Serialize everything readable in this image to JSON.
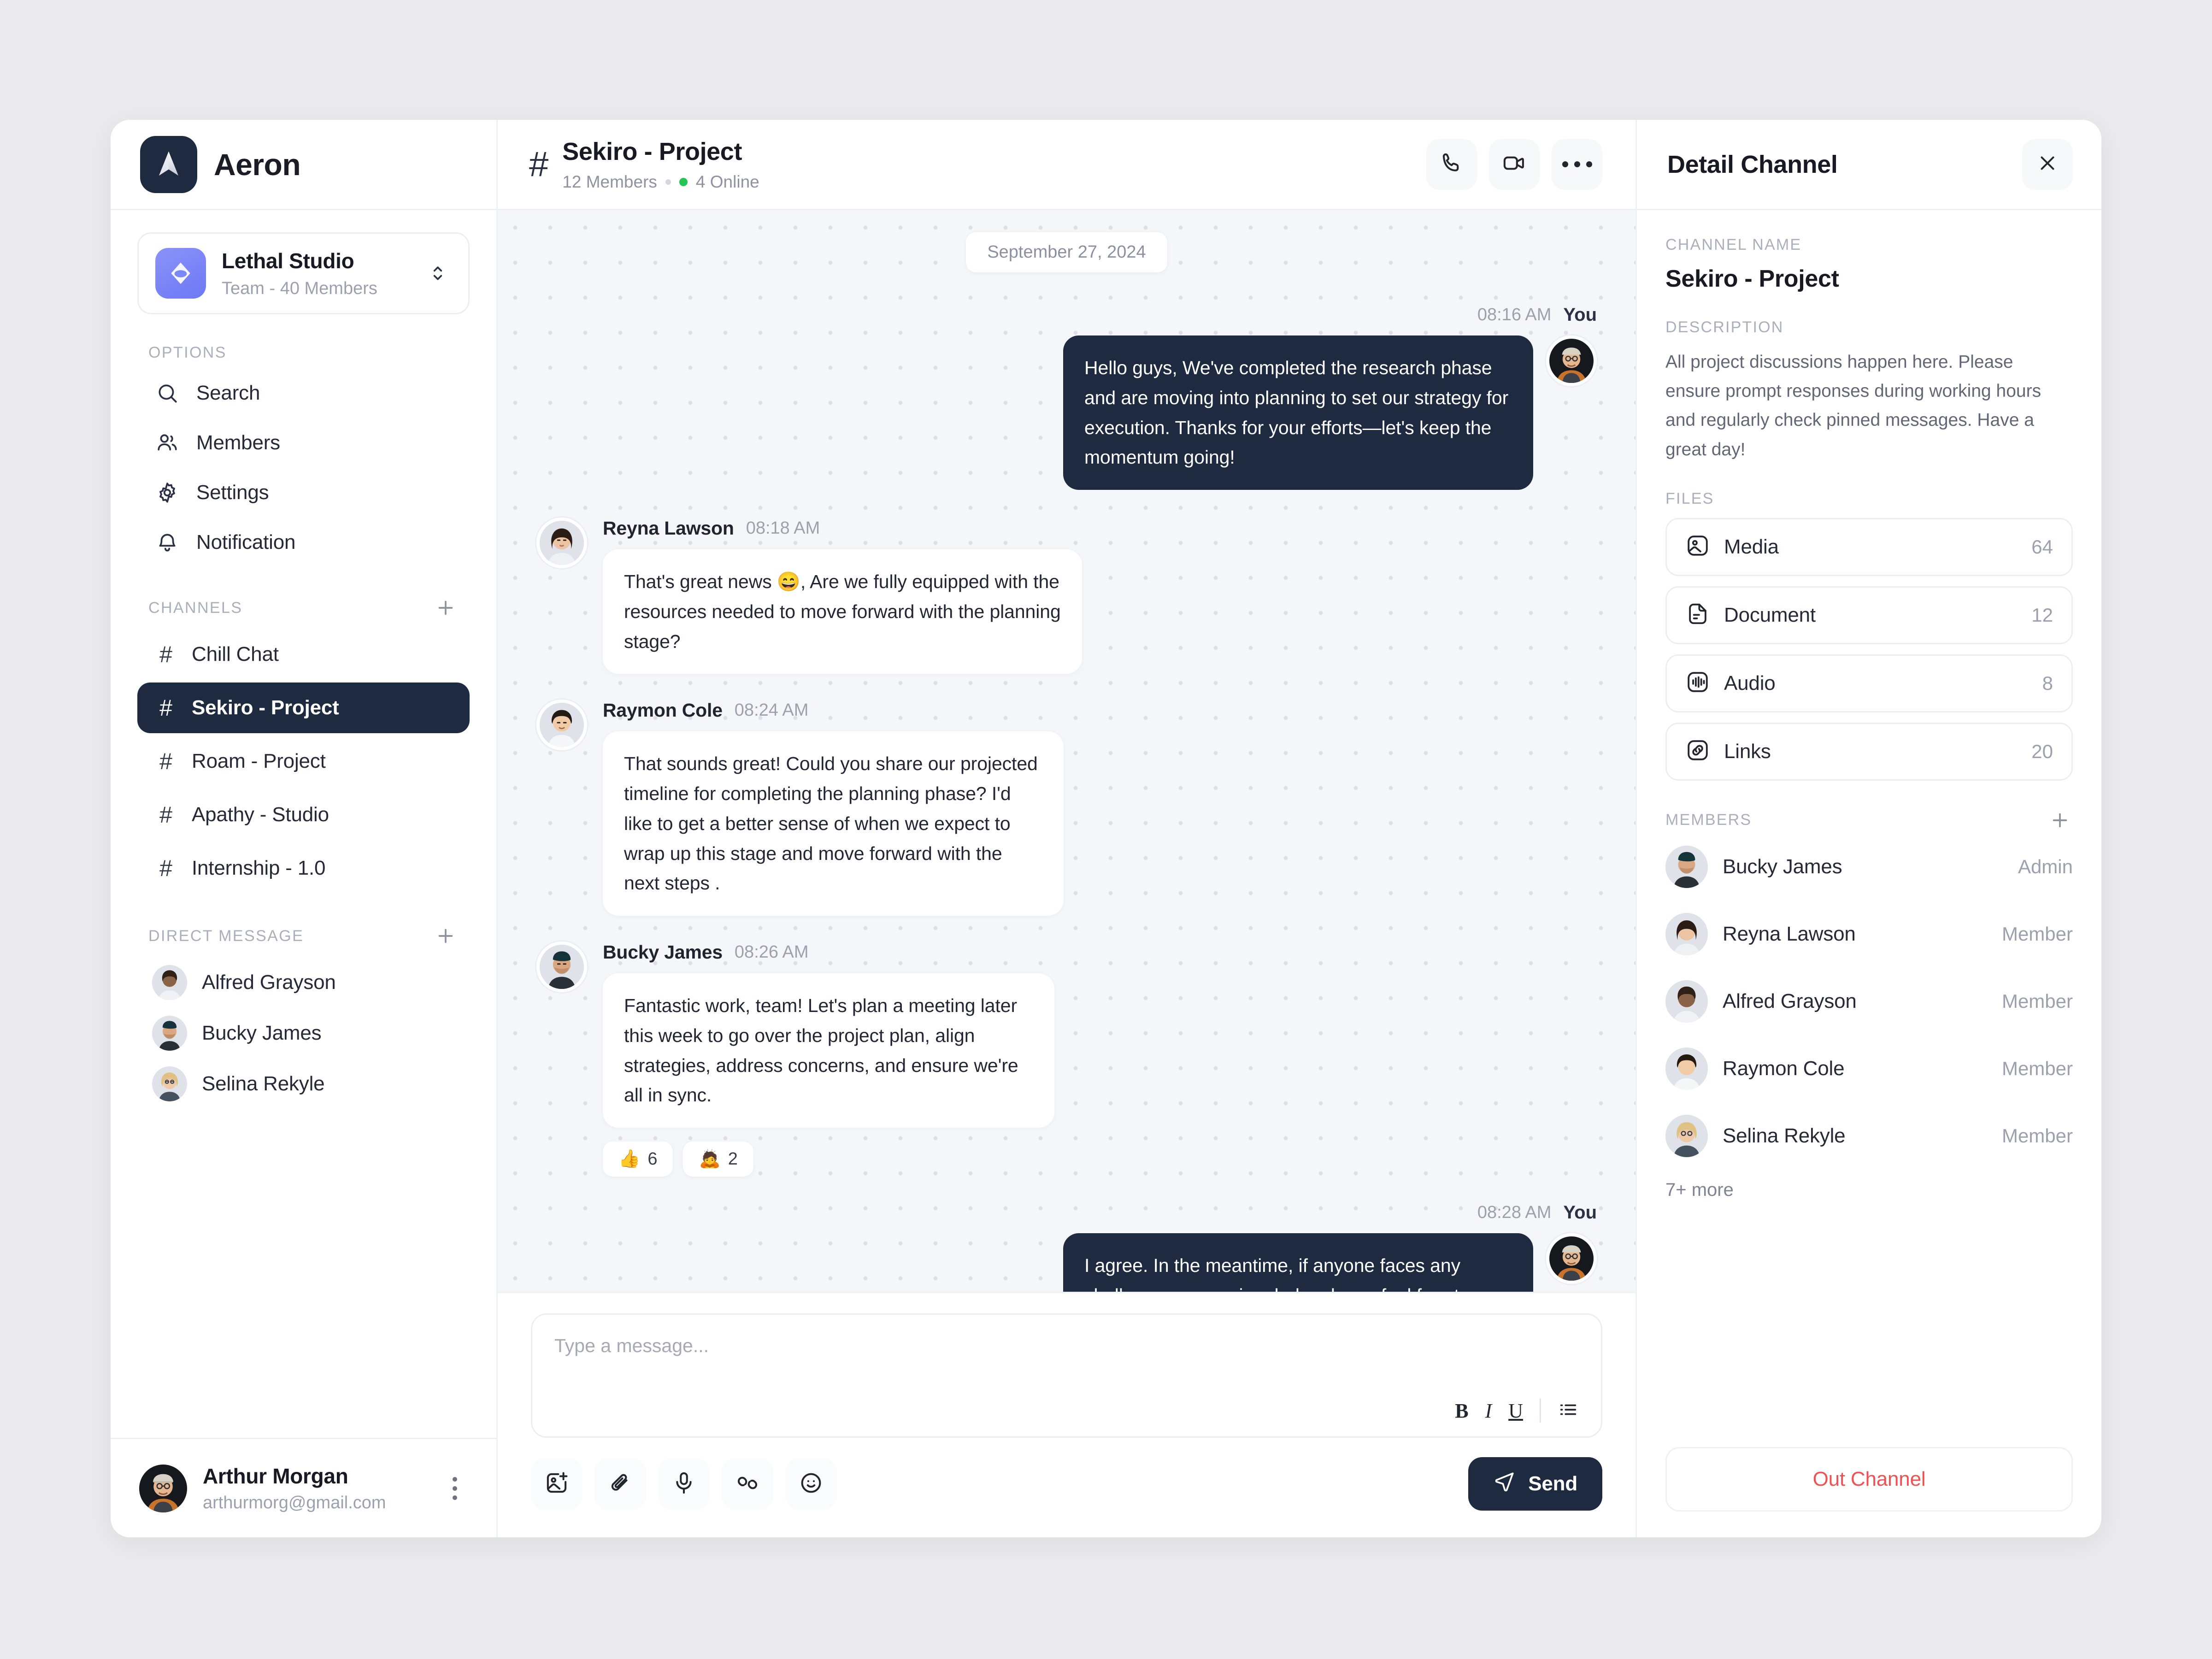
{
  "brand": {
    "name": "Aeron",
    "logo_icon": "aeron-logo-icon"
  },
  "workspace": {
    "name": "Lethal Studio",
    "subtitle": "Team - 40 Members",
    "switch_icon": "chevron-up-down-icon"
  },
  "sidebar": {
    "options_label": "OPTIONS",
    "options": [
      {
        "label": "Search",
        "icon": "search-icon"
      },
      {
        "label": "Members",
        "icon": "users-icon"
      },
      {
        "label": "Settings",
        "icon": "gear-icon"
      },
      {
        "label": "Notification",
        "icon": "bell-icon"
      }
    ],
    "channels_label": "CHANNELS",
    "add_channel_icon": "plus-icon",
    "channels": [
      {
        "label": "Chill Chat",
        "active": false
      },
      {
        "label": "Sekiro - Project",
        "active": true
      },
      {
        "label": "Roam - Project",
        "active": false
      },
      {
        "label": "Apathy - Studio",
        "active": false
      },
      {
        "label": "Internship - 1.0",
        "active": false
      }
    ],
    "dm_label": "DIRECT MESSAGE",
    "add_dm_icon": "plus-icon",
    "direct_messages": [
      {
        "label": "Alfred Grayson"
      },
      {
        "label": "Bucky James"
      },
      {
        "label": "Selina Rekyle"
      }
    ]
  },
  "current_user": {
    "name": "Arthur Morgan",
    "email": "arthurmorg@gmail.com",
    "menu_icon": "more-vertical-icon"
  },
  "chat_header": {
    "hash_icon": "hash-icon",
    "title": "Sekiro - Project",
    "members_text": "12 Members",
    "online_text": "4 Online",
    "actions": [
      {
        "icon": "phone-icon",
        "name": "voice-call-button"
      },
      {
        "icon": "video-icon",
        "name": "video-call-button"
      },
      {
        "icon": "more-horizontal-icon",
        "name": "more-options-button"
      }
    ]
  },
  "conversation": {
    "date_divider": "September 27, 2024",
    "messages": [
      {
        "side": "out",
        "author": "You",
        "time": "08:16 AM",
        "text": "Hello guys, We've completed the research phase and are moving into planning to set our strategy for execution. Thanks for your efforts—let's keep the momentum going!"
      },
      {
        "side": "in",
        "author": "Reyna Lawson",
        "time": "08:18 AM",
        "text": "That's great news 😄, Are we fully equipped with the resources needed to move forward with the planning stage?"
      },
      {
        "side": "in",
        "author": "Raymon Cole",
        "time": "08:24 AM",
        "text": "That sounds great! Could you share our projected timeline for completing the planning phase? I'd like to get a better sense of when we expect to wrap up this stage and move forward with the next steps ."
      },
      {
        "side": "in",
        "author": "Bucky James",
        "time": "08:26 AM",
        "text": "Fantastic work, team! Let's plan a meeting later this week to go over the project plan, align strategies, address concerns, and ensure we're all in sync.",
        "reactions": [
          {
            "emoji": "👍",
            "count": "6"
          },
          {
            "emoji": "🙇",
            "count": "2"
          }
        ]
      },
      {
        "side": "out",
        "author": "You",
        "time": "08:28 AM",
        "text": "I agree. In the meantime, if anyone faces any challenges or requires help, please feel free to reach out to the team for support. We're here to assist each other 💪."
      }
    ]
  },
  "composer": {
    "placeholder": "Type a message...",
    "format": {
      "bold": "B",
      "italic": "I",
      "underline": "U",
      "list_icon": "list-icon"
    },
    "tools": [
      {
        "icon": "image-plus-icon",
        "name": "attach-image-button"
      },
      {
        "icon": "paperclip-icon",
        "name": "attach-file-button"
      },
      {
        "icon": "microphone-icon",
        "name": "voice-record-button"
      },
      {
        "icon": "link-icon",
        "name": "insert-link-button"
      },
      {
        "icon": "smiley-icon",
        "name": "emoji-picker-button"
      }
    ],
    "send_label": "Send",
    "send_icon": "send-icon"
  },
  "detail": {
    "title": "Detail Channel",
    "close_icon": "close-icon",
    "channel_name_label": "CHANNEL NAME",
    "channel_name": "Sekiro - Project",
    "description_label": "DESCRIPTION",
    "description": "All project discussions happen here. Please ensure prompt responses during working hours and regularly check pinned messages. Have a great day!",
    "files_label": "FILES",
    "files": [
      {
        "name": "Media",
        "count": "64",
        "icon": "image-icon"
      },
      {
        "name": "Document",
        "count": "12",
        "icon": "document-icon"
      },
      {
        "name": "Audio",
        "count": "8",
        "icon": "audio-wave-icon"
      },
      {
        "name": "Links",
        "count": "20",
        "icon": "link-icon"
      }
    ],
    "members_label": "MEMBERS",
    "add_member_icon": "plus-icon",
    "members": [
      {
        "name": "Bucky James",
        "role": "Admin"
      },
      {
        "name": "Reyna Lawson",
        "role": "Member"
      },
      {
        "name": "Alfred Grayson",
        "role": "Member"
      },
      {
        "name": "Raymon Cole",
        "role": "Member"
      },
      {
        "name": "Selina Rekyle",
        "role": "Member"
      }
    ],
    "more_members": "7+ more",
    "out_channel_label": "Out Channel"
  },
  "colors": {
    "page_bg": "#ebebed",
    "dark": "#1e2a40",
    "accent_purple": "#6d78f5",
    "online_green": "#25c455",
    "danger_red": "#f05252",
    "chat_bg": "#f5f6f9"
  }
}
